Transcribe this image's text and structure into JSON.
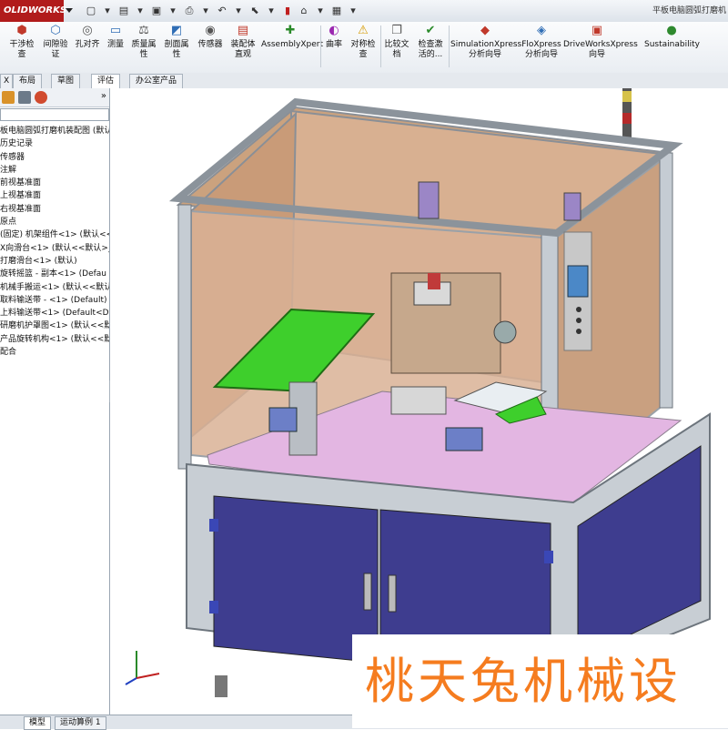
{
  "app": {
    "logo_text": "OLIDWORKS",
    "document_title": "平板电脑圆弧打磨机"
  },
  "quick_access": [
    "menu-arrow",
    "new-icon",
    "open-icon",
    "save-icon",
    "print-icon",
    "undo-icon",
    "select-icon",
    "rebuild-icon",
    "file-props-icon",
    "options-icon"
  ],
  "ribbon": {
    "buttons": [
      {
        "label": "干涉检\n查",
        "icon": "interference-icon"
      },
      {
        "label": "间隙验\n证",
        "icon": "clearance-icon"
      },
      {
        "label": "孔对齐",
        "icon": "hole-align-icon"
      },
      {
        "label": "测量",
        "icon": "measure-icon"
      },
      {
        "label": "质量属\n性",
        "icon": "mass-props-icon"
      },
      {
        "label": "剖面属\n性",
        "icon": "section-props-icon"
      },
      {
        "label": "传感器",
        "icon": "sensor-icon"
      },
      {
        "label": "装配体\n直观",
        "icon": "assembly-visual-icon"
      },
      {
        "label": "AssemblyXpert",
        "icon": "assembly-xpert-icon"
      },
      {
        "label": "曲率",
        "icon": "curvature-icon"
      },
      {
        "label": "对称检\n查",
        "icon": "symmetry-icon"
      },
      {
        "label": "比较文\n档",
        "icon": "compare-icon"
      },
      {
        "label": "检查激\n活的...",
        "icon": "check-active-icon"
      },
      {
        "label": "SimulationXpress\n分析向导",
        "icon": "simulation-icon"
      },
      {
        "label": "FloXpress\n分析向导",
        "icon": "floxpress-icon"
      },
      {
        "label": "DriveWorksXpress\n向导",
        "icon": "driveworks-icon"
      },
      {
        "label": "Sustainability",
        "icon": "sustainability-icon"
      }
    ]
  },
  "tabs": [
    {
      "label": "X"
    },
    {
      "label": "布局"
    },
    {
      "label": "草图"
    },
    {
      "label": "评估",
      "active": true
    },
    {
      "label": "办公室产品"
    }
  ],
  "feature_tree": {
    "expand_label": "»",
    "items": [
      "板电脑圆弧打磨机装配图  (默认",
      "历史记录",
      "传感器",
      "注解",
      "前视基准面",
      "上视基准面",
      "右视基准面",
      "原点",
      "(固定) 机架组件<1> (默认<<",
      "X向滑台<1> (默认<<默认>_",
      "打磨滑台<1> (默认)",
      "旋转摇篮 - 副本<1> (Defau",
      "机械手搬运<1> (默认<<默认",
      "取料输送带 - <1> (Default)",
      "上料输送带<1> (Default<D",
      "研磨机护罩图<1> (默认<<默",
      "产品旋转机构<1> (默认<<默",
      "配合"
    ]
  },
  "status_tabs": [
    {
      "label": "模型",
      "active": true
    },
    {
      "label": "运动算例 1"
    }
  ],
  "watermark_text": "桃天兔机械设",
  "colors": {
    "logo_bg": "#b11b1b",
    "enclosure_glass": "#c99b78",
    "frame": "#c5ccd3",
    "cabinet_door": "#3e3d8f",
    "conveyor_green": "#3ecf2c",
    "base_plate_pink": "#e3b6e2",
    "watermark": "#f57c1f"
  }
}
